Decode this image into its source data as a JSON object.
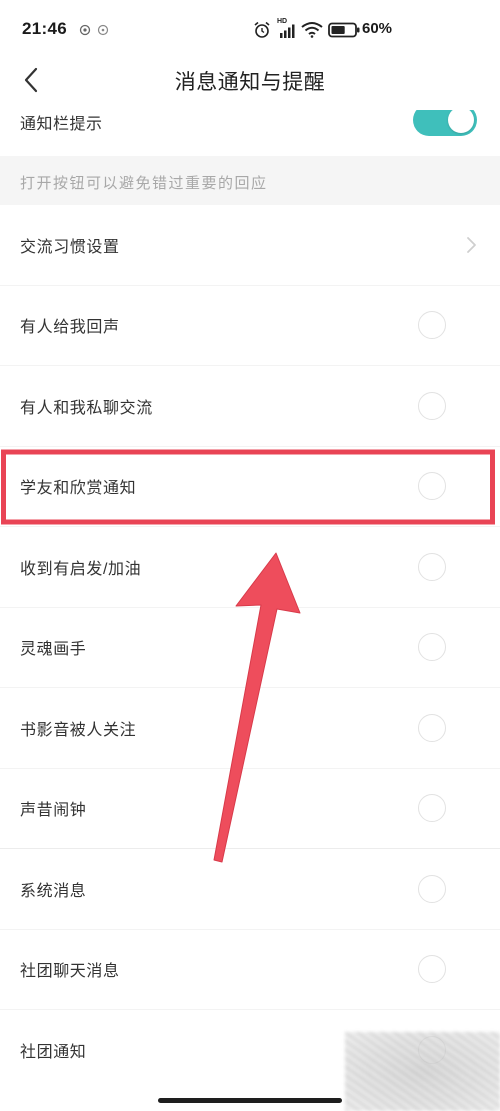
{
  "status_bar": {
    "time": "21:46",
    "network_label": "HD",
    "battery_text": "60%",
    "battery_level": 0.6,
    "icons": [
      "notification-icon",
      "notification-icon",
      "alarm-icon",
      "cellular-signal-icon",
      "wifi-icon",
      "battery-icon"
    ]
  },
  "header": {
    "title": "消息通知与提醒",
    "back_icon": "chevron-left-icon"
  },
  "partial_item": {
    "label": "通知栏提示",
    "toggle_on": true
  },
  "section_hint": "打开按钮可以避免错过重要的回应",
  "items": [
    {
      "label": "交流习惯设置",
      "control": "chevron"
    },
    {
      "label": "有人给我回声",
      "control": "radio",
      "checked": false
    },
    {
      "label": "有人和我私聊交流",
      "control": "radio",
      "checked": false
    },
    {
      "label": "学友和欣赏通知",
      "control": "radio",
      "checked": false,
      "highlighted": true
    },
    {
      "label": "收到有启发/加油",
      "control": "radio",
      "checked": false
    },
    {
      "label": "灵魂画手",
      "control": "radio",
      "checked": false
    },
    {
      "label": "书影音被人关注",
      "control": "radio",
      "checked": false
    },
    {
      "label": "声昔闹钟",
      "control": "radio",
      "checked": false
    },
    {
      "label": "系统消息",
      "control": "radio",
      "checked": false
    },
    {
      "label": "社团聊天消息",
      "control": "radio",
      "checked": false
    },
    {
      "label": "社团通知",
      "control": "radio",
      "checked": false
    }
  ],
  "colors": {
    "accent": "#3fbfbb",
    "annotation": "#e94455",
    "text": "#333333",
    "hint": "#a8a8a8"
  }
}
